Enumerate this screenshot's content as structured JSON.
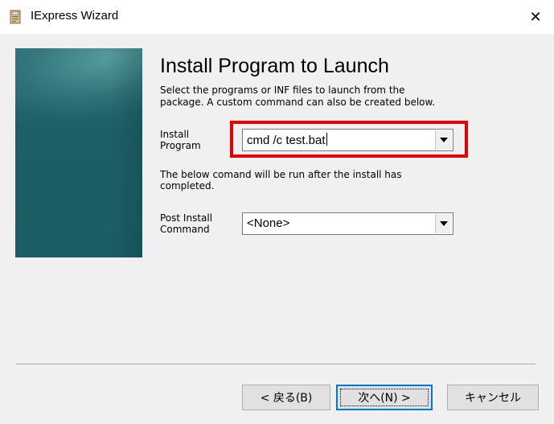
{
  "window": {
    "title": "IExpress Wizard",
    "close_glyph": "✕"
  },
  "page": {
    "heading": "Install Program to Launch",
    "description": "Select the programs or INF files to launch from the\npackage.  A custom command can also be created below."
  },
  "install_program": {
    "label": "Install\nProgram",
    "value": "cmd /c test.bat"
  },
  "post_note": "The below comand will be run after the install has\ncompleted.",
  "post_install": {
    "label": "Post Install\nCommand",
    "value": "<None>"
  },
  "buttons": {
    "back": "< 戻る(B)",
    "next": "次へ(N) >",
    "cancel": "キャンセル"
  },
  "colors": {
    "highlight": "#e60000",
    "side_image": "#1d5f66"
  },
  "icons": {
    "app": "iexpress-app-icon",
    "dropdown": "chevron-down-icon",
    "close": "close-icon"
  }
}
